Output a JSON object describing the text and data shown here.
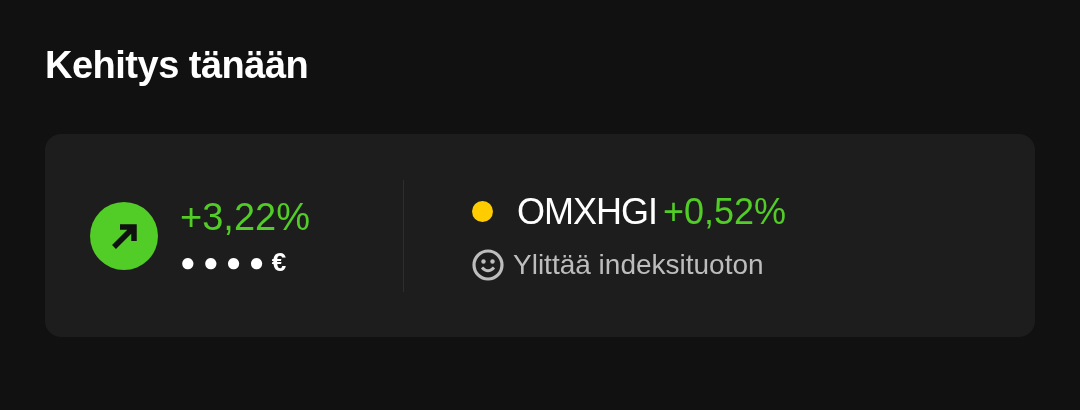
{
  "title": "Kehitys tänään",
  "performance": {
    "rising": true,
    "change": "+3,22%",
    "amount": "● ● ● ● €"
  },
  "index": {
    "color": "#ffcc00",
    "name": "OMXHGI",
    "change": "+0,52%",
    "comparison": "Ylittää indeksituoton"
  }
}
